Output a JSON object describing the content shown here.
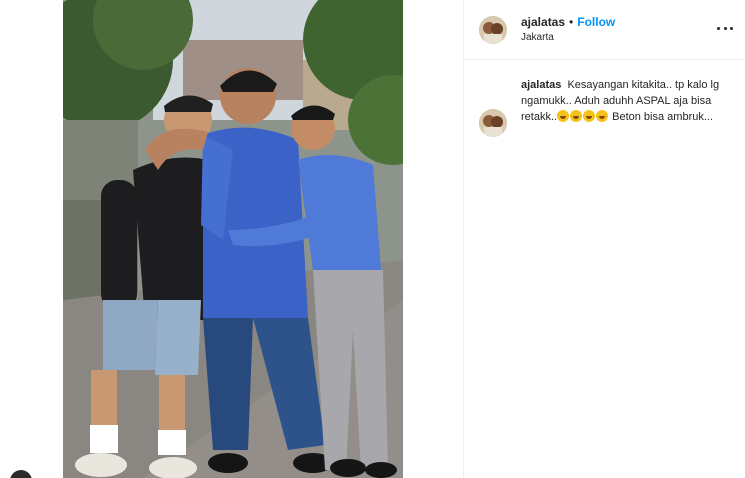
{
  "post": {
    "username": "ajalatas",
    "separator": "•",
    "follow_label": "Follow",
    "location": "Jakarta"
  },
  "caption": {
    "username": "ajalatas",
    "text_before": "Kesayangan kitakita.. tp kalo lg ngamukk.. Aduh aduhh ASPAL aja bisa retakk..",
    "emojis": [
      "rolling-on-floor-laughing",
      "grinning-sweat",
      "rolling-on-floor-laughing",
      "grinning-sweat"
    ],
    "text_after": " Beton bisa ambruk..."
  },
  "icons": {
    "more": "more-options-icon",
    "nav": "carousel-nav-icon"
  },
  "colors": {
    "follow": "#0095f6",
    "divider": "#efefef",
    "text": "#262626"
  }
}
